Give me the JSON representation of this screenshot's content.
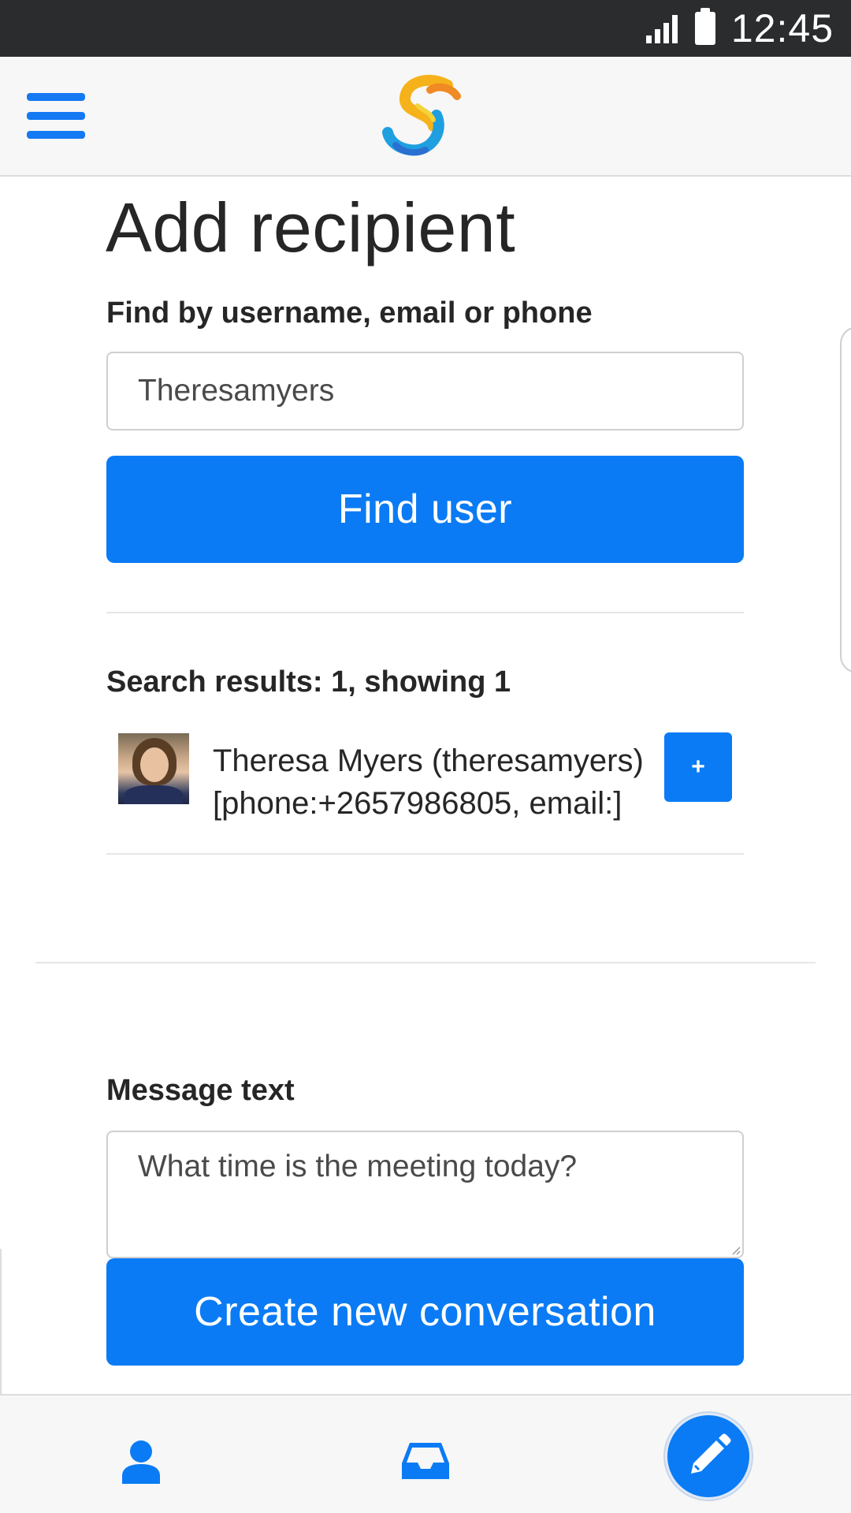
{
  "status_bar": {
    "time": "12:45",
    "icons": [
      "signal-icon",
      "battery-icon"
    ]
  },
  "header": {
    "menu_icon": "hamburger-menu-icon",
    "logo": "swirl-logo"
  },
  "page": {
    "title": "Add recipient",
    "search_label": "Find by username, email or phone",
    "search_value": "Theresamyers",
    "find_button": "Find user",
    "results_summary": "Search results: 1, showing 1",
    "results": [
      {
        "name_line": "Theresa Myers (theresamyers)",
        "detail_line": "[phone:+2657986805, email:]",
        "add_label": "+"
      }
    ],
    "message_label": "Message text",
    "message_value": "What time is the meeting today?",
    "create_button": "Create new conversation"
  },
  "bottom_nav": {
    "items": [
      "profile-icon",
      "inbox-icon",
      "compose-pencil-icon"
    ]
  },
  "colors": {
    "primary": "#0a7bf5",
    "status_bar": "#2b2c2e",
    "nav_bg": "#f7f7f7"
  }
}
